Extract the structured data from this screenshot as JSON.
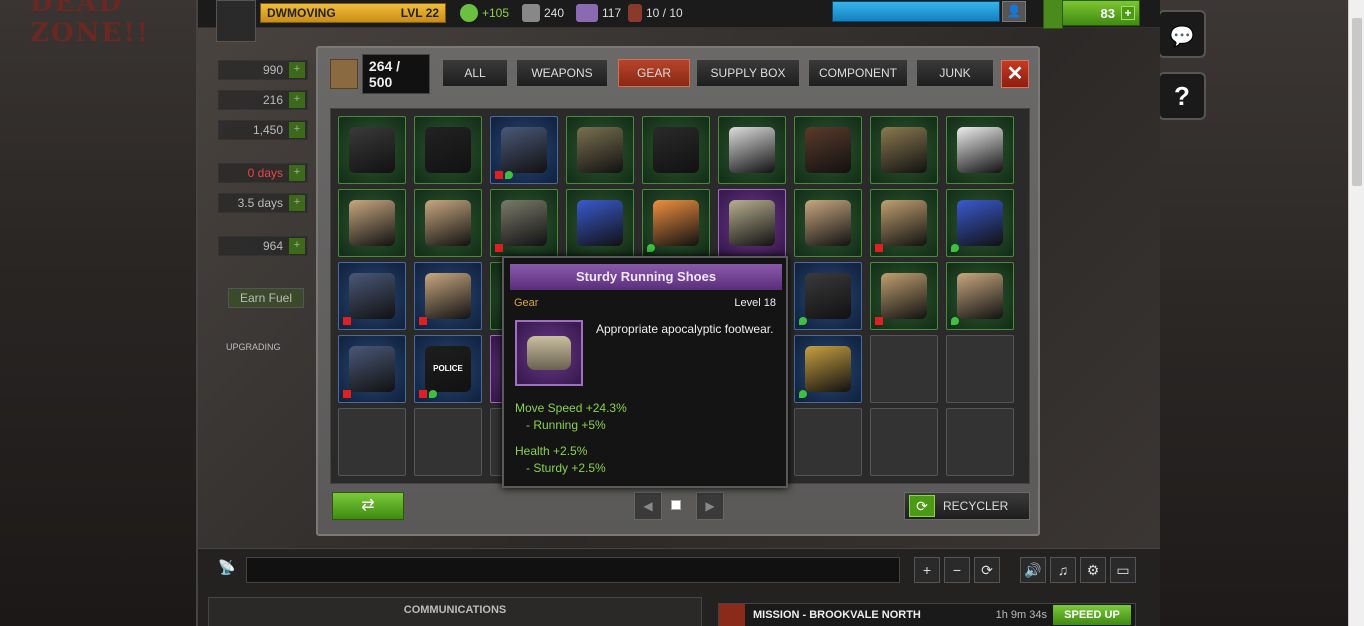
{
  "background": {
    "logo_text": "DEAD ZONE!!"
  },
  "topbar": {
    "player_name": "DWMOVING",
    "level": "LVL 22",
    "morale": "+105",
    "defense": "240",
    "comfort": "117",
    "security": "10 / 10",
    "cash": "83",
    "cash_plus": "+",
    "friend_icon": "add-friend-icon"
  },
  "resources": [
    {
      "value": "990",
      "plus": "+"
    },
    {
      "value": "216",
      "plus": "+"
    },
    {
      "value": "1,450",
      "plus": "+"
    },
    {
      "value": "0 days",
      "plus": "+"
    },
    {
      "value": "3.5 days",
      "plus": "+"
    },
    {
      "value": "964",
      "plus": "+"
    }
  ],
  "left_panel": {
    "earn_fuel": "Earn Fuel",
    "upgrading": "UPGRADING"
  },
  "side_buttons": {
    "chat": "💬",
    "help": "?"
  },
  "inventory": {
    "count": "264 / 500",
    "tabs": [
      {
        "label": "ALL",
        "active": false
      },
      {
        "label": "WEAPONS",
        "active": false
      },
      {
        "label": "GEAR",
        "active": true
      },
      {
        "label": "SUPPLY BOX",
        "active": false
      },
      {
        "label": "COMPONENT",
        "active": false
      },
      {
        "label": "JUNK",
        "active": false
      }
    ],
    "close_label": "✕",
    "recycler_label": "RECYCLER",
    "prev_label": "◀",
    "next_label": "▶",
    "swap_label": "⇄",
    "slots": [
      [
        {
          "bg": "green",
          "item": "vest-icon",
          "color": "#3a3a3a"
        },
        {
          "bg": "green",
          "item": "boots-icon",
          "color": "#222222"
        },
        {
          "bg": "blue",
          "item": "magazine-icon",
          "color": "#4a5878",
          "r": true,
          "g": true
        },
        {
          "bg": "green",
          "item": "pouch-icon",
          "color": "#7a7050"
        },
        {
          "bg": "green",
          "item": "armor-icon",
          "color": "#2a2a2a"
        },
        {
          "bg": "green",
          "item": "glasses-icon",
          "color": "#dddddd"
        },
        {
          "bg": "green",
          "item": "gloves-icon",
          "color": "#5a3a2a"
        },
        {
          "bg": "green",
          "item": "ammo-belt-icon",
          "color": "#8a7a50"
        },
        {
          "bg": "green",
          "item": "sneakers-icon",
          "color": "#eeeeee"
        }
      ],
      [
        {
          "bg": "green",
          "item": "boots-icon",
          "color": "#c8a880"
        },
        {
          "bg": "green",
          "item": "boots-icon",
          "color": "#c8a880"
        },
        {
          "bg": "green",
          "item": "vest-icon",
          "color": "#7a7a6a",
          "r": true
        },
        {
          "bg": "green",
          "item": "goggles-icon",
          "color": "#3a5ad0"
        },
        {
          "bg": "green",
          "item": "goggles-icon",
          "color": "#f09040",
          "g": true,
          "solo": true
        },
        {
          "bg": "purple",
          "item": "running-shoes-icon",
          "color": "#b8b090"
        },
        {
          "bg": "green",
          "item": "boots-icon",
          "color": "#c8a880"
        },
        {
          "bg": "green",
          "item": "gloves-icon",
          "color": "#c0a070",
          "r": true
        },
        {
          "bg": "green",
          "item": "goggles-icon",
          "color": "#3a5ad0",
          "g": true,
          "solo": true
        }
      ],
      [
        {
          "bg": "blue",
          "item": "magazine-icon",
          "color": "#4a5878",
          "r": true
        },
        {
          "bg": "blue",
          "item": "boots-icon",
          "color": "#c8a880",
          "r": true
        },
        {
          "bg": "green",
          "item": "",
          "color": ""
        },
        {
          "bg": "none",
          "item": "",
          "color": ""
        },
        {
          "bg": "none",
          "item": "",
          "color": ""
        },
        {
          "bg": "none",
          "item": "",
          "color": ""
        },
        {
          "bg": "blue",
          "item": "vest-icon",
          "color": "#3a3a3a",
          "g": true,
          "solo": true
        },
        {
          "bg": "green",
          "item": "gloves-icon",
          "color": "#c0a070",
          "r": true
        },
        {
          "bg": "green",
          "item": "boots-icon",
          "color": "#c8a880",
          "g": true,
          "solo": true
        }
      ],
      [
        {
          "bg": "blue",
          "item": "magazine-icon",
          "color": "#4a5878",
          "r": true
        },
        {
          "bg": "blue",
          "item": "police-vest-icon",
          "color": "#1e1e1e",
          "r": true,
          "g": true,
          "text": "POLICE"
        },
        {
          "bg": "purple",
          "item": "",
          "color": ""
        },
        {
          "bg": "none",
          "item": "",
          "color": ""
        },
        {
          "bg": "none",
          "item": "",
          "color": ""
        },
        {
          "bg": "none",
          "item": "",
          "color": ""
        },
        {
          "bg": "blue",
          "item": "bullets-icon",
          "color": "#c8a040",
          "g": true,
          "solo": true
        },
        {
          "bg": "empty",
          "item": "",
          "color": ""
        },
        {
          "bg": "empty",
          "item": "",
          "color": ""
        }
      ],
      [
        {
          "bg": "empty",
          "item": "",
          "color": ""
        },
        {
          "bg": "empty",
          "item": "",
          "color": ""
        },
        {
          "bg": "empty",
          "item": "",
          "color": ""
        },
        {
          "bg": "none",
          "item": "",
          "color": ""
        },
        {
          "bg": "none",
          "item": "",
          "color": ""
        },
        {
          "bg": "none",
          "item": "",
          "color": ""
        },
        {
          "bg": "empty",
          "item": "",
          "color": ""
        },
        {
          "bg": "empty",
          "item": "",
          "color": ""
        },
        {
          "bg": "empty",
          "item": "",
          "color": ""
        }
      ]
    ]
  },
  "tooltip": {
    "title": "Sturdy Running Shoes",
    "category": "Gear",
    "level": "Level 18",
    "description": "Appropriate apocalyptic footwear.",
    "stats": [
      {
        "name": "Move Speed +24.3%",
        "sub": "- Running +5%"
      },
      {
        "name": "Health +2.5%",
        "sub": "- Sturdy +2.5%"
      }
    ]
  },
  "bottom": {
    "controls": [
      "+",
      "−",
      "⟳",
      "🔊",
      "♫",
      "⚙",
      "▭"
    ],
    "communications": "COMMUNICATIONS",
    "mission": "MISSION - BROOKVALE NORTH",
    "mission_timer": "1h 9m 34s",
    "speed_up": "SPEED UP"
  }
}
